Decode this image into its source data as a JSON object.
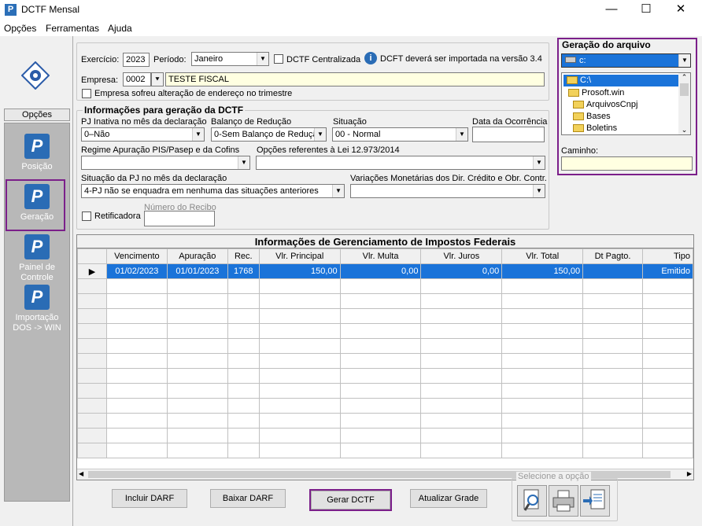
{
  "window": {
    "title": "DCTF Mensal",
    "minimize": "—",
    "maximize": "☐",
    "close": "✕"
  },
  "menu": {
    "items": [
      "Opções",
      "Ferramentas",
      "Ajuda"
    ]
  },
  "sidebar": {
    "header": "Opções",
    "items": [
      {
        "label": "Posição"
      },
      {
        "label": "Geração"
      },
      {
        "label": "Painel de Controle"
      },
      {
        "label": "Importação DOS -> WIN"
      }
    ]
  },
  "form": {
    "exercicio_label": "Exercício:",
    "exercicio_value": "2023",
    "periodo_label": "Período:",
    "periodo_value": "Janeiro",
    "centralizada_label": "DCTF Centralizada",
    "info_text": "DCFT deverá ser importada na versão 3.4",
    "empresa_label": "Empresa:",
    "empresa_code": "0002",
    "empresa_name": "TESTE FISCAL",
    "endereco_label": "Empresa sofreu alteração de endereço no trimestre",
    "info_group_title": "Informações para geração da DCTF",
    "pj_inativa_label": "PJ Inativa no mês da declaração",
    "pj_inativa_value": "0–Não",
    "balanco_label": "Balanço de Redução",
    "balanco_value": "0-Sem Balanço de Redução",
    "situacao_label": "Situação",
    "situacao_value": "00 - Normal",
    "data_ocorrencia_label": "Data da Ocorrência",
    "regime_label": "Regime Apuração PIS/Pasep e da Cofins",
    "opcoes_lei_label": "Opções referentes à Lei 12.973/2014",
    "situacao_pj_label": "Situação da PJ no mês da declaração",
    "situacao_pj_value": "4-PJ não se enquadra em nenhuma das situações anteriores",
    "variacoes_label": "Variações Monetárias dos Dir. Crédito e Obr. Contr.",
    "retificadora_label": "Retificadora",
    "numero_recibo_label": "Número do Recibo"
  },
  "file_panel": {
    "title": "Geração do arquivo",
    "drive": "c:",
    "folders": [
      "C:\\",
      "Prosoft.win",
      "ArquivosCnpj",
      "Bases",
      "Boletins"
    ],
    "caminho_label": "Caminho:"
  },
  "grid": {
    "title": "Informações de Gerenciamento de Impostos Federais",
    "columns": [
      "Vencimento",
      "Apuração",
      "Rec.",
      "Vlr. Principal",
      "Vlr. Multa",
      "Vlr. Juros",
      "Vlr. Total",
      "Dt Pagto.",
      "Tipo"
    ],
    "rows": [
      [
        "01/02/2023",
        "01/01/2023",
        "1768",
        "150,00",
        "0,00",
        "0,00",
        "150,00",
        "",
        "Emitido"
      ]
    ],
    "row_marker": "▶"
  },
  "buttons": {
    "incluir": "Incluir DARF",
    "baixar": "Baixar DARF",
    "gerar": "Gerar DCTF",
    "atualizar": "Atualizar Grade",
    "selecione_label": "Selecione a opção"
  }
}
